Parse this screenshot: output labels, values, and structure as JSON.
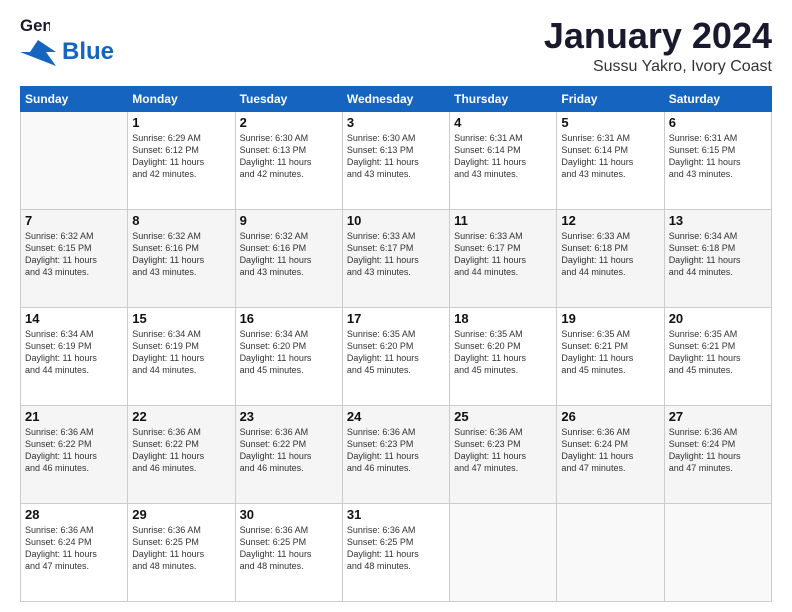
{
  "header": {
    "logo_line1": "General",
    "logo_line2": "Blue",
    "title": "January 2024",
    "subtitle": "Sussu Yakro, Ivory Coast"
  },
  "calendar": {
    "days_of_week": [
      "Sunday",
      "Monday",
      "Tuesday",
      "Wednesday",
      "Thursday",
      "Friday",
      "Saturday"
    ],
    "rows": [
      {
        "shaded": false,
        "cells": [
          {
            "day": "",
            "info": ""
          },
          {
            "day": "1",
            "info": "Sunrise: 6:29 AM\nSunset: 6:12 PM\nDaylight: 11 hours\nand 42 minutes."
          },
          {
            "day": "2",
            "info": "Sunrise: 6:30 AM\nSunset: 6:13 PM\nDaylight: 11 hours\nand 42 minutes."
          },
          {
            "day": "3",
            "info": "Sunrise: 6:30 AM\nSunset: 6:13 PM\nDaylight: 11 hours\nand 43 minutes."
          },
          {
            "day": "4",
            "info": "Sunrise: 6:31 AM\nSunset: 6:14 PM\nDaylight: 11 hours\nand 43 minutes."
          },
          {
            "day": "5",
            "info": "Sunrise: 6:31 AM\nSunset: 6:14 PM\nDaylight: 11 hours\nand 43 minutes."
          },
          {
            "day": "6",
            "info": "Sunrise: 6:31 AM\nSunset: 6:15 PM\nDaylight: 11 hours\nand 43 minutes."
          }
        ]
      },
      {
        "shaded": true,
        "cells": [
          {
            "day": "7",
            "info": "Sunrise: 6:32 AM\nSunset: 6:15 PM\nDaylight: 11 hours\nand 43 minutes."
          },
          {
            "day": "8",
            "info": "Sunrise: 6:32 AM\nSunset: 6:16 PM\nDaylight: 11 hours\nand 43 minutes."
          },
          {
            "day": "9",
            "info": "Sunrise: 6:32 AM\nSunset: 6:16 PM\nDaylight: 11 hours\nand 43 minutes."
          },
          {
            "day": "10",
            "info": "Sunrise: 6:33 AM\nSunset: 6:17 PM\nDaylight: 11 hours\nand 43 minutes."
          },
          {
            "day": "11",
            "info": "Sunrise: 6:33 AM\nSunset: 6:17 PM\nDaylight: 11 hours\nand 44 minutes."
          },
          {
            "day": "12",
            "info": "Sunrise: 6:33 AM\nSunset: 6:18 PM\nDaylight: 11 hours\nand 44 minutes."
          },
          {
            "day": "13",
            "info": "Sunrise: 6:34 AM\nSunset: 6:18 PM\nDaylight: 11 hours\nand 44 minutes."
          }
        ]
      },
      {
        "shaded": false,
        "cells": [
          {
            "day": "14",
            "info": "Sunrise: 6:34 AM\nSunset: 6:19 PM\nDaylight: 11 hours\nand 44 minutes."
          },
          {
            "day": "15",
            "info": "Sunrise: 6:34 AM\nSunset: 6:19 PM\nDaylight: 11 hours\nand 44 minutes."
          },
          {
            "day": "16",
            "info": "Sunrise: 6:34 AM\nSunset: 6:20 PM\nDaylight: 11 hours\nand 45 minutes."
          },
          {
            "day": "17",
            "info": "Sunrise: 6:35 AM\nSunset: 6:20 PM\nDaylight: 11 hours\nand 45 minutes."
          },
          {
            "day": "18",
            "info": "Sunrise: 6:35 AM\nSunset: 6:20 PM\nDaylight: 11 hours\nand 45 minutes."
          },
          {
            "day": "19",
            "info": "Sunrise: 6:35 AM\nSunset: 6:21 PM\nDaylight: 11 hours\nand 45 minutes."
          },
          {
            "day": "20",
            "info": "Sunrise: 6:35 AM\nSunset: 6:21 PM\nDaylight: 11 hours\nand 45 minutes."
          }
        ]
      },
      {
        "shaded": true,
        "cells": [
          {
            "day": "21",
            "info": "Sunrise: 6:36 AM\nSunset: 6:22 PM\nDaylight: 11 hours\nand 46 minutes."
          },
          {
            "day": "22",
            "info": "Sunrise: 6:36 AM\nSunset: 6:22 PM\nDaylight: 11 hours\nand 46 minutes."
          },
          {
            "day": "23",
            "info": "Sunrise: 6:36 AM\nSunset: 6:22 PM\nDaylight: 11 hours\nand 46 minutes."
          },
          {
            "day": "24",
            "info": "Sunrise: 6:36 AM\nSunset: 6:23 PM\nDaylight: 11 hours\nand 46 minutes."
          },
          {
            "day": "25",
            "info": "Sunrise: 6:36 AM\nSunset: 6:23 PM\nDaylight: 11 hours\nand 47 minutes."
          },
          {
            "day": "26",
            "info": "Sunrise: 6:36 AM\nSunset: 6:24 PM\nDaylight: 11 hours\nand 47 minutes."
          },
          {
            "day": "27",
            "info": "Sunrise: 6:36 AM\nSunset: 6:24 PM\nDaylight: 11 hours\nand 47 minutes."
          }
        ]
      },
      {
        "shaded": false,
        "cells": [
          {
            "day": "28",
            "info": "Sunrise: 6:36 AM\nSunset: 6:24 PM\nDaylight: 11 hours\nand 47 minutes."
          },
          {
            "day": "29",
            "info": "Sunrise: 6:36 AM\nSunset: 6:25 PM\nDaylight: 11 hours\nand 48 minutes."
          },
          {
            "day": "30",
            "info": "Sunrise: 6:36 AM\nSunset: 6:25 PM\nDaylight: 11 hours\nand 48 minutes."
          },
          {
            "day": "31",
            "info": "Sunrise: 6:36 AM\nSunset: 6:25 PM\nDaylight: 11 hours\nand 48 minutes."
          },
          {
            "day": "",
            "info": ""
          },
          {
            "day": "",
            "info": ""
          },
          {
            "day": "",
            "info": ""
          }
        ]
      }
    ]
  }
}
